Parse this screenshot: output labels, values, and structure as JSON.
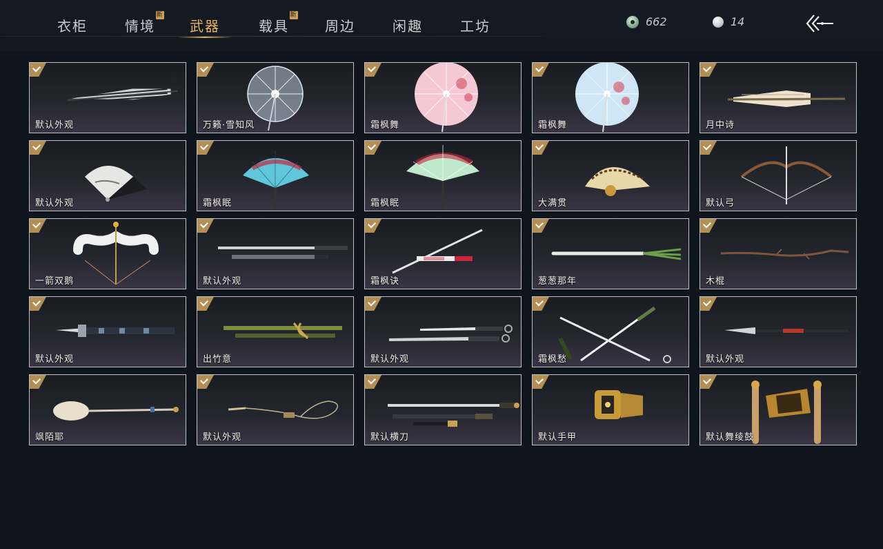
{
  "nav": {
    "tabs": [
      {
        "label": "衣柜"
      },
      {
        "label": "情境",
        "badge": "新"
      },
      {
        "label": "武器"
      },
      {
        "label": "载具",
        "badge": "新"
      },
      {
        "label": "周边"
      },
      {
        "label": "闲趣"
      },
      {
        "label": "工坊"
      }
    ],
    "active_tab": "武器"
  },
  "currency": {
    "jade": {
      "value": "662",
      "icon": "jade-coin-icon"
    },
    "pearl": {
      "value": "14",
      "icon": "pearl-icon"
    }
  },
  "back_icon": "back-arrow-icon",
  "items": [
    {
      "label": "默认外观",
      "icon": "umbrella-closed-striped",
      "owned": true
    },
    {
      "label": "万籁·雪知风",
      "icon": "umbrella-open-ice",
      "owned": true
    },
    {
      "label": "霜枫舞",
      "icon": "umbrella-open-pink",
      "owned": true
    },
    {
      "label": "霜枫舞",
      "icon": "umbrella-open-blue",
      "owned": true
    },
    {
      "label": "月中诗",
      "icon": "umbrella-closed-cream",
      "owned": true
    },
    {
      "label": "默认外观",
      "icon": "fan-ink",
      "owned": true
    },
    {
      "label": "霜枫眠",
      "icon": "fan-cyan-maple",
      "owned": true
    },
    {
      "label": "霜枫眠",
      "icon": "fan-green-maple",
      "owned": true
    },
    {
      "label": "大满贯",
      "icon": "fan-gold",
      "owned": true
    },
    {
      "label": "默认弓",
      "icon": "bow-wood",
      "owned": true
    },
    {
      "label": "一箭双鹅",
      "icon": "bow-goose",
      "owned": true
    },
    {
      "label": "默认外观",
      "icon": "sword-pair-silver",
      "owned": true
    },
    {
      "label": "霜枫诀",
      "icon": "sword-diagonal-red",
      "owned": true
    },
    {
      "label": "葱葱那年",
      "icon": "scallion",
      "owned": true
    },
    {
      "label": "木棍",
      "icon": "wooden-stick",
      "owned": true
    },
    {
      "label": "默认外观",
      "icon": "blade-ornate",
      "owned": true
    },
    {
      "label": "出竹意",
      "icon": "bamboo-blades",
      "owned": true
    },
    {
      "label": "默认外观",
      "icon": "dao-pair",
      "owned": true
    },
    {
      "label": "霜枫愁",
      "icon": "crossed-swords",
      "owned": true
    },
    {
      "label": "默认外观",
      "icon": "spear-dark",
      "owned": true
    },
    {
      "label": "飒陌耶",
      "icon": "spoon-staff",
      "owned": true
    },
    {
      "label": "默认外观",
      "icon": "rope-dart",
      "owned": true
    },
    {
      "label": "默认横刀",
      "icon": "hengdao-pair",
      "owned": true
    },
    {
      "label": "默认手甲",
      "icon": "gauntlet-gold",
      "owned": true
    },
    {
      "label": "默认舞绫鼓",
      "icon": "drum-sticks",
      "owned": true
    }
  ],
  "colors": {
    "accent": "#e2ad58",
    "background": "#0f151c",
    "check": "#b38f55"
  }
}
